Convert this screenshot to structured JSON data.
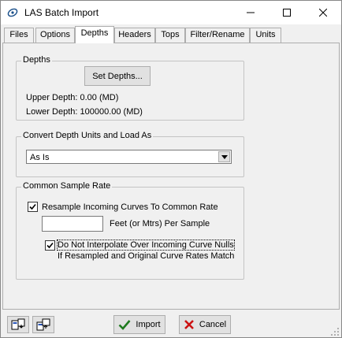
{
  "window": {
    "title": "LAS Batch Import"
  },
  "tabs": [
    {
      "label": "Files"
    },
    {
      "label": "Options"
    },
    {
      "label": "Depths"
    },
    {
      "label": "Headers"
    },
    {
      "label": "Tops"
    },
    {
      "label": "Filter/Rename"
    },
    {
      "label": "Units"
    }
  ],
  "depths": {
    "group_title": "Depths",
    "set_button": "Set Depths...",
    "upper": "Upper Depth: 0.00 (MD)",
    "lower": "Lower Depth: 100000.00 (MD)"
  },
  "convert": {
    "group_title": "Convert Depth Units and Load As",
    "selected": "As Is"
  },
  "sample": {
    "group_title": "Common Sample Rate",
    "resample_label": "Resample Incoming Curves To Common Rate",
    "resample_checked": true,
    "rate_value": "",
    "rate_unit_label": "Feet (or Mtrs) Per Sample",
    "nointerp_label": "Do Not Interpolate Over Incoming Curve Nulls",
    "nointerp_checked": true,
    "nointerp_note": "If Resampled and Original Curve Rates Match"
  },
  "footer": {
    "import_label": "Import",
    "cancel_label": "Cancel"
  },
  "colors": {
    "check_green": "#1e7a1e",
    "cancel_red": "#cc1111"
  }
}
